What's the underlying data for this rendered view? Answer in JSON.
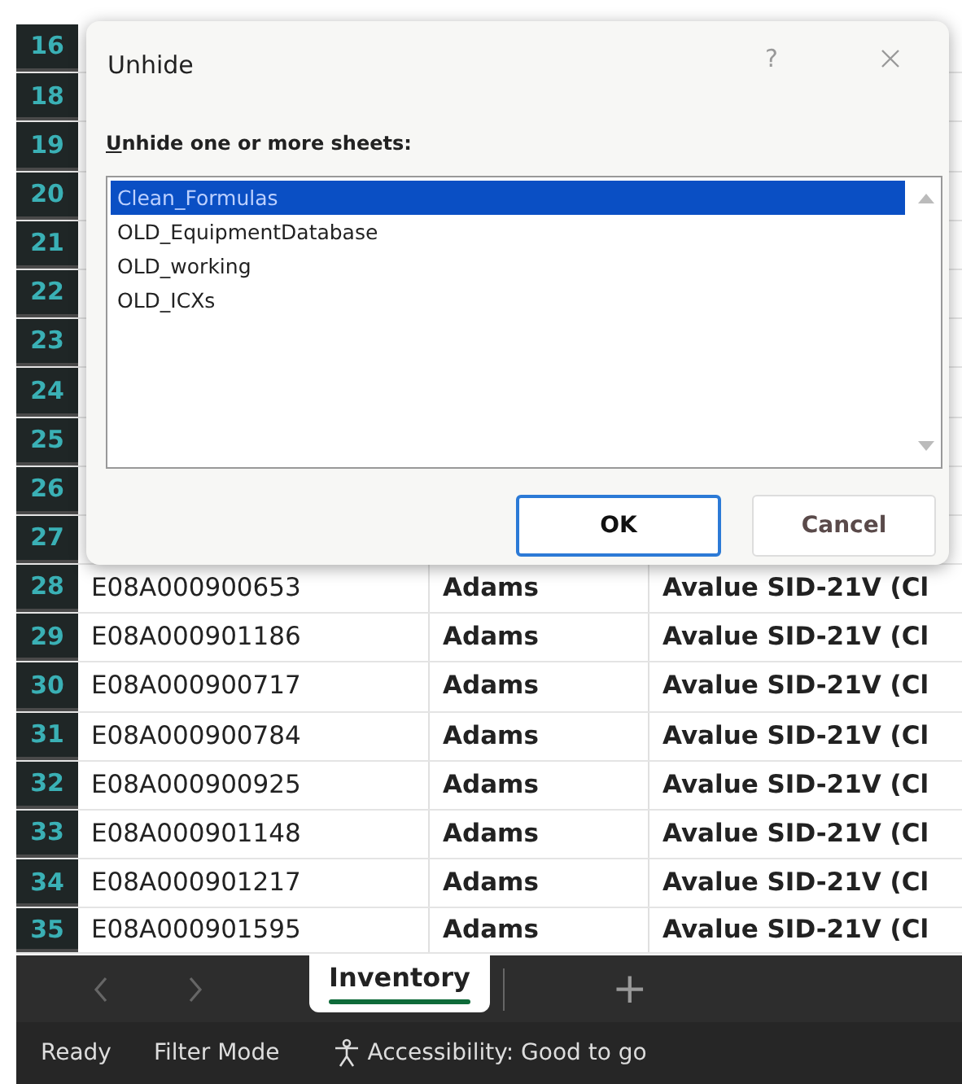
{
  "hidden_rows": [
    "16",
    "18",
    "19",
    "20",
    "21",
    "22",
    "23",
    "24",
    "25",
    "26",
    "27"
  ],
  "rows": [
    {
      "number": "28",
      "cells": [
        "E08A000900653",
        "Adams",
        "Avalue SID-21V (Cl"
      ]
    },
    {
      "number": "29",
      "cells": [
        "E08A000901186",
        "Adams",
        "Avalue SID-21V (Cl"
      ]
    },
    {
      "number": "30",
      "cells": [
        "E08A000900717",
        "Adams",
        "Avalue SID-21V (Cl"
      ]
    },
    {
      "number": "31",
      "cells": [
        "E08A000900784",
        "Adams",
        "Avalue SID-21V (Cl"
      ]
    },
    {
      "number": "32",
      "cells": [
        "E08A000900925",
        "Adams",
        "Avalue SID-21V (Cl"
      ]
    },
    {
      "number": "33",
      "cells": [
        "E08A000901148",
        "Adams",
        "Avalue SID-21V (Cl"
      ]
    },
    {
      "number": "34",
      "cells": [
        "E08A000901217",
        "Adams",
        "Avalue SID-21V (Cl"
      ]
    },
    {
      "number": "35",
      "cells": [
        "E08A000901595",
        "Adams",
        "Avalue SID-21V (Cl"
      ]
    }
  ],
  "dialog": {
    "title": "Unhide",
    "help": "?",
    "label": "Unhide one or more sheets:",
    "sheets": [
      {
        "name": "Clean_Formulas",
        "selected": true
      },
      {
        "name": "OLD_EquipmentDatabase",
        "selected": false
      },
      {
        "name": "OLD_working",
        "selected": false
      },
      {
        "name": "OLD_ICXs",
        "selected": false
      }
    ],
    "buttons": [
      {
        "label": "OK",
        "default": true
      },
      {
        "label": "Cancel",
        "default": false
      }
    ]
  },
  "sheet_tabs": {
    "tabs": [
      {
        "label": "Inventory",
        "selected": true
      }
    ],
    "add": "+"
  },
  "status_bar": {
    "items": [
      "Ready",
      "Filter Mode"
    ],
    "accessibility": "Accessibility: Good to go"
  }
}
